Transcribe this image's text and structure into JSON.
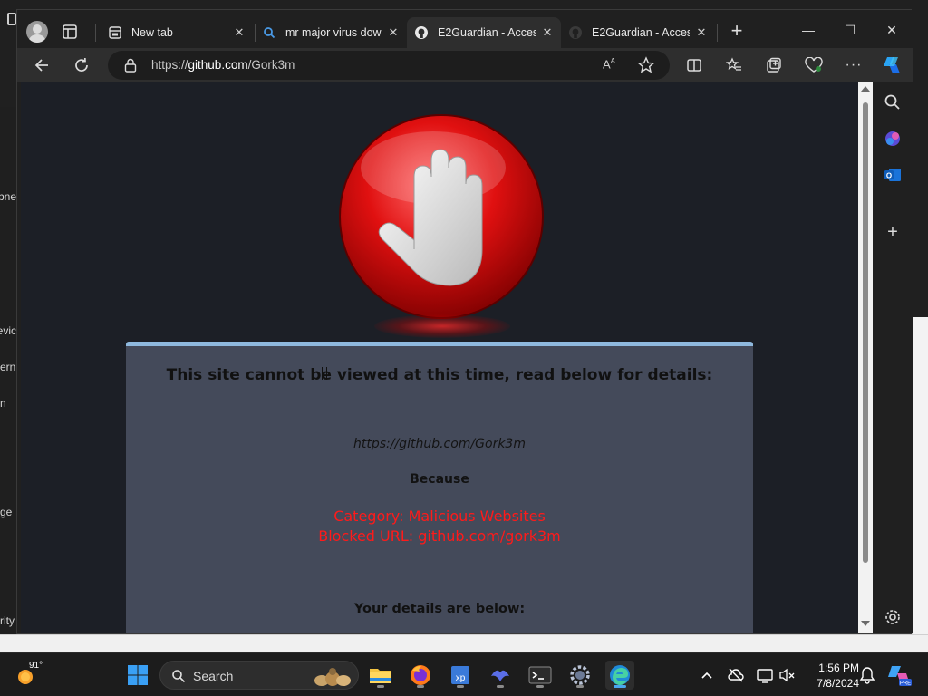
{
  "background_app": {
    "sidebar_fragments": [
      "bne",
      "evic",
      "ern",
      "n",
      "ge",
      "rity"
    ]
  },
  "browser": {
    "tabs": [
      {
        "label": "New tab",
        "icon": "new-tab-page-icon",
        "active": false
      },
      {
        "label": "mr major virus dow",
        "icon": "search-icon",
        "active": false
      },
      {
        "label": "E2Guardian - Acces",
        "icon": "github-icon",
        "active": true
      },
      {
        "label": "E2Guardian - Acces",
        "icon": "github-icon",
        "active": false
      }
    ],
    "new_tab_symbol": "+",
    "window_controls": {
      "minimize": "—",
      "maximize": "☐",
      "close": "✕"
    },
    "address": {
      "prefix": "https://",
      "host": "github.com",
      "path": "/Gork3m"
    }
  },
  "page": {
    "title": "This site cannot be viewed at this time, read below for details:",
    "blocked_url": "https://github.com/Gork3m",
    "because": "Because",
    "category": "Category: Malicious Websites",
    "blocked": "Blocked URL: github.com/gork3m",
    "details_heading": "Your details are below:"
  },
  "taskbar": {
    "weather_temp": "91°",
    "search_label": "Search",
    "time": "1:56 PM",
    "date": "7/8/2024"
  },
  "colors": {
    "accent_red": "#ff1a1a",
    "box_top_border": "#8fb9de",
    "box_bg": "#444a5a",
    "page_bg": "#1c1f26"
  }
}
